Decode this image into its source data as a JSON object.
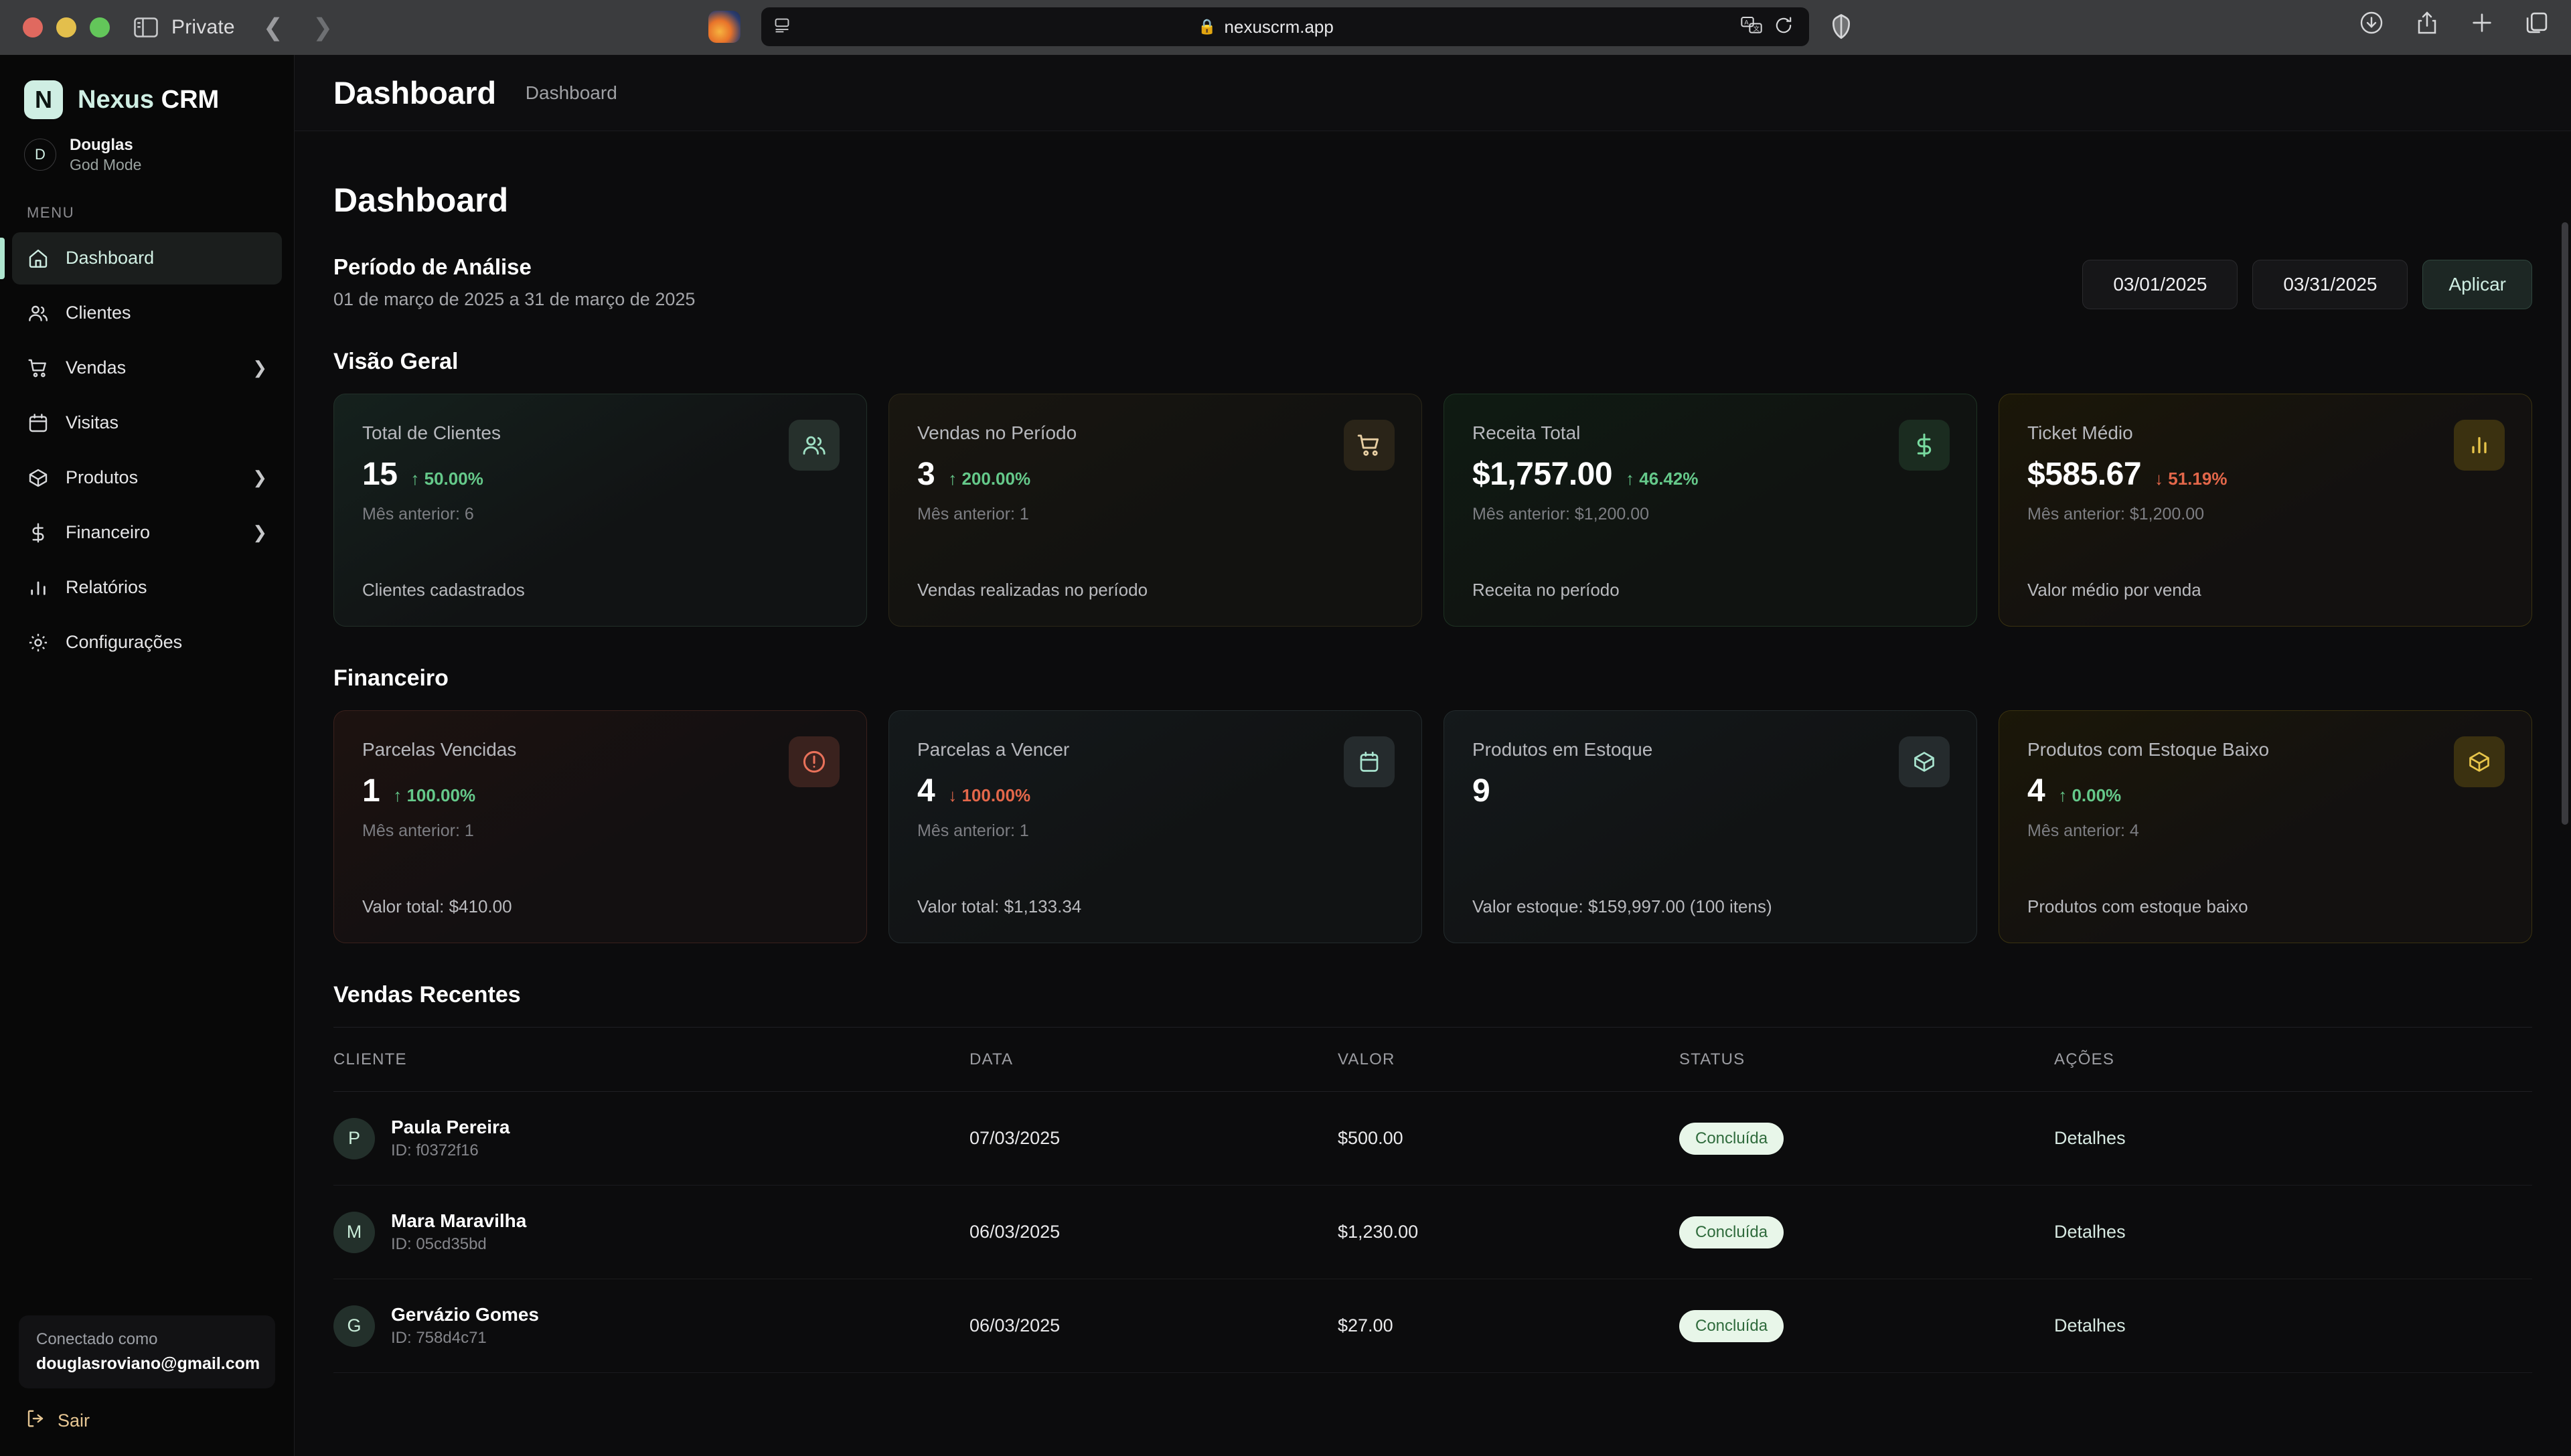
{
  "browser": {
    "private_label": "Private",
    "url": "nexuscrm.app",
    "back_icon": "chevron-left-icon",
    "forward_icon": "chevron-right-icon",
    "sidebar_icon": "sidebar-toggle-icon",
    "lock_icon": "lock-icon",
    "translate_icon": "translate-icon",
    "reload_icon": "reload-icon",
    "shield_icon": "shield-icon",
    "download_icon": "download-icon",
    "share_icon": "share-icon",
    "newtab_icon": "plus-icon",
    "tabs_icon": "tab-overview-icon"
  },
  "sidebar": {
    "brand_mark": "N",
    "brand_first": "Nexus",
    "brand_second": "CRM",
    "user": {
      "initial": "D",
      "name": "Douglas",
      "role": "God Mode"
    },
    "menu_label": "MENU",
    "items": [
      {
        "label": "Dashboard",
        "icon": "home-icon",
        "active": true,
        "expandable": false
      },
      {
        "label": "Clientes",
        "icon": "users-icon",
        "active": false,
        "expandable": false
      },
      {
        "label": "Vendas",
        "icon": "cart-icon",
        "active": false,
        "expandable": true
      },
      {
        "label": "Visitas",
        "icon": "calendar-icon",
        "active": false,
        "expandable": false
      },
      {
        "label": "Produtos",
        "icon": "box-icon",
        "active": false,
        "expandable": true
      },
      {
        "label": "Financeiro",
        "icon": "dollar-icon",
        "active": false,
        "expandable": true
      },
      {
        "label": "Relatórios",
        "icon": "bar-chart-icon",
        "active": false,
        "expandable": false
      },
      {
        "label": "Configurações",
        "icon": "gear-icon",
        "active": false,
        "expandable": false
      }
    ],
    "footer": {
      "connected_label": "Conectado como",
      "email": "douglasroviano@gmail.com",
      "logout_label": "Sair",
      "logout_icon": "logout-icon"
    }
  },
  "topbar": {
    "title": "Dashboard",
    "breadcrumb": "Dashboard"
  },
  "page": {
    "title": "Dashboard",
    "period": {
      "title": "Período de Análise",
      "subtitle": "01 de março de 2025 a 31 de março de 2025",
      "start_date": "03/01/2025",
      "end_date": "03/31/2025",
      "apply_label": "Aplicar"
    },
    "overview_title": "Visão Geral",
    "overview_cards": [
      {
        "label": "Total de Clientes",
        "value": "15",
        "delta": "50.00%",
        "dir": "up",
        "prev": "Mês anterior: 6",
        "foot": "Clientes cadastrados",
        "icon": "users-icon",
        "tone": "teal"
      },
      {
        "label": "Vendas no Período",
        "value": "3",
        "delta": "200.00%",
        "dir": "up",
        "prev": "Mês anterior: 1",
        "foot": "Vendas realizadas no período",
        "icon": "cart-icon",
        "tone": "amber"
      },
      {
        "label": "Receita Total",
        "value": "$1,757.00",
        "delta": "46.42%",
        "dir": "up",
        "prev": "Mês anterior: $1,200.00",
        "foot": "Receita no período",
        "icon": "dollar-icon",
        "tone": "green"
      },
      {
        "label": "Ticket Médio",
        "value": "$585.67",
        "delta": "51.19%",
        "dir": "down",
        "prev": "Mês anterior: $1,200.00",
        "foot": "Valor médio por venda",
        "icon": "bar-chart-icon",
        "tone": "gold"
      }
    ],
    "financial_title": "Financeiro",
    "financial_cards": [
      {
        "label": "Parcelas Vencidas",
        "value": "1",
        "delta": "100.00%",
        "dir": "up",
        "prev": "Mês anterior: 1",
        "foot": "Valor total: $410.00",
        "icon": "alert-circle-icon",
        "tone": "red"
      },
      {
        "label": "Parcelas a Vencer",
        "value": "4",
        "delta": "100.00%",
        "dir": "down",
        "prev": "Mês anterior: 1",
        "foot": "Valor total: $1,133.34",
        "icon": "calendar-icon",
        "tone": "slate"
      },
      {
        "label": "Produtos em Estoque",
        "value": "9",
        "delta": "",
        "dir": "",
        "prev": "",
        "foot": "Valor estoque: $159,997.00 (100 itens)",
        "icon": "box-icon",
        "tone": "slate"
      },
      {
        "label": "Produtos com Estoque Baixo",
        "value": "4",
        "delta": "0.00%",
        "dir": "up",
        "prev": "Mês anterior: 4",
        "foot": "Produtos com estoque baixo",
        "icon": "box-icon",
        "tone": "gold"
      }
    ],
    "recent_sales": {
      "title": "Vendas Recentes",
      "columns": [
        "CLIENTE",
        "DATA",
        "VALOR",
        "STATUS",
        "AÇÕES"
      ],
      "rows": [
        {
          "initial": "P",
          "name": "Paula Pereira",
          "id": "ID: f0372f16",
          "date": "07/03/2025",
          "value": "$500.00",
          "status": "Concluída",
          "action": "Detalhes"
        },
        {
          "initial": "M",
          "name": "Mara Maravilha",
          "id": "ID: 05cd35bd",
          "date": "06/03/2025",
          "value": "$1,230.00",
          "status": "Concluída",
          "action": "Detalhes"
        },
        {
          "initial": "G",
          "name": "Gervázio Gomes",
          "id": "ID: 758d4c71",
          "date": "06/03/2025",
          "value": "$27.00",
          "status": "Concluída",
          "action": "Detalhes"
        }
      ]
    }
  },
  "colors": {
    "accent": "#cfeee3",
    "positive": "#65c98a",
    "negative": "#e3674a",
    "badge_bg": "#e8f6e9",
    "badge_fg": "#2f6b3c"
  }
}
